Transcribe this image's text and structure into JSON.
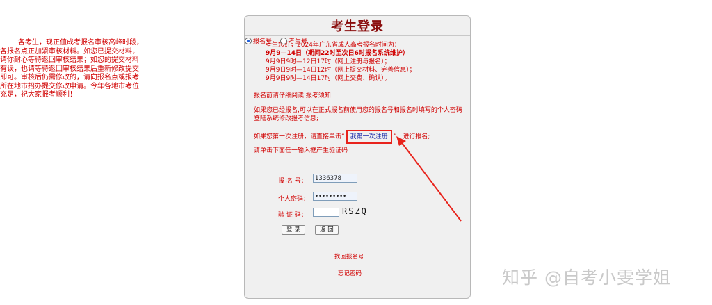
{
  "notice": {
    "text": "各考生，现正值成考报名审核高峰时段，各报名点正加紧审核材料。如您已提交材料，请你耐心等待返回审核结果；如您的提交材料有误，也请等待返回审核结果后重新修改提交即可。审核后仍需修改的，请向报名点或报考所在地市招办提交修改申请。今年各地市考位充足，祝大家报考顺利！"
  },
  "panel": {
    "title": "考生登录",
    "times": {
      "intro": "考生您好，2024年广东省成人高考报名时间为：",
      "line1": "9月9—14日（期间22时至次日6时报名系统维护）",
      "line2": "9月9日9时—12日17时（网上注册与报名）；",
      "line3": "9月9日9时—14日12时（网上提交材料、完善信息）；",
      "line4": "9月9日9时—14日17时（网上交费、确认）。"
    },
    "read_first_prefix": "报名前请仔细阅读 ",
    "read_first_link": "报考须知",
    "registered_text": "如果您已经报名,可以在正式报名前使用您的报名号和报名时填写的个人密码登陆系统修改报考信息;",
    "first_reg_prefix": "如果您第一次注册，请直接单击“",
    "first_reg_link": "我第一次注册",
    "first_reg_suffix": "”，进行报名;",
    "captcha_prompt": "请单击下面任一输入框产生验证码",
    "radio_1": "报名号",
    "radio_2": "考生号",
    "label_regno": "报 名 号：",
    "value_regno": "1336378",
    "label_password": "个人密码：",
    "value_password": "•••••••••",
    "label_captcha": "验 证 码：",
    "captcha_code": "RSZQ",
    "login_button": "登 录",
    "back_button": "返 回",
    "recover_link": "找回报名号",
    "forgot_link": "忘记密码"
  },
  "watermark": "知乎 @自考小雯学姐",
  "colors": {
    "red": "#d10000",
    "title": "#8a0e0e",
    "link_blue": "#1a2aa8",
    "highlight": "#e8231c"
  }
}
